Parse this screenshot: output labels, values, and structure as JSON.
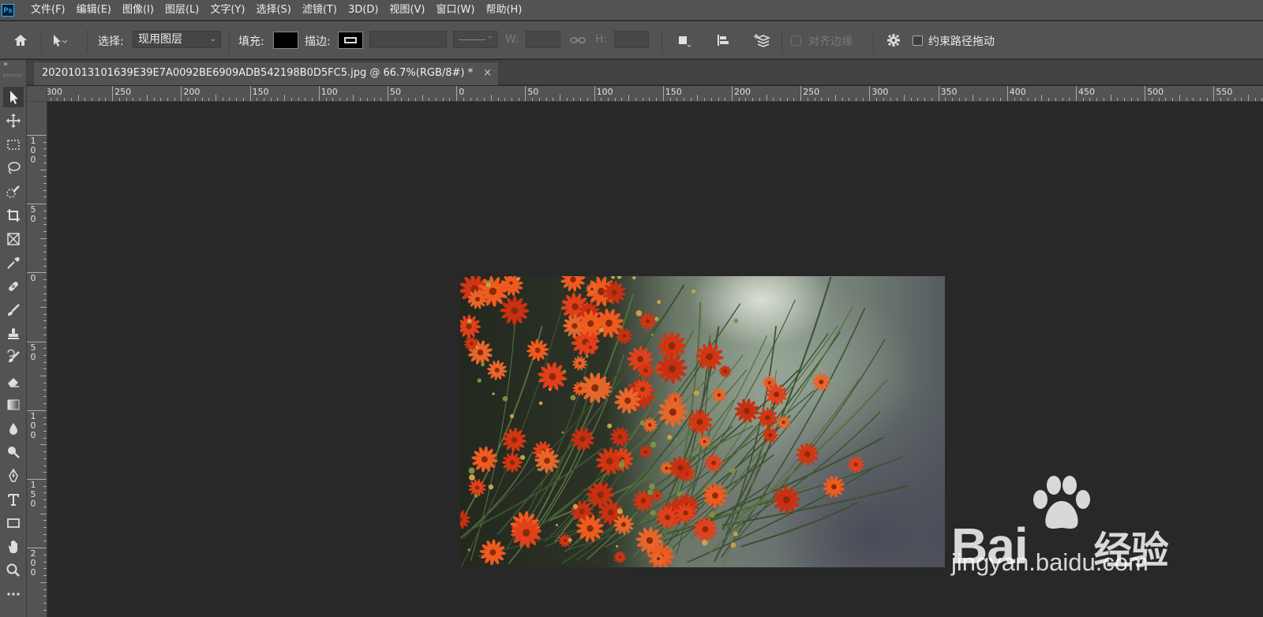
{
  "app": {
    "logo_text": "Ps"
  },
  "menu": [
    {
      "label": "文件(F)"
    },
    {
      "label": "编辑(E)"
    },
    {
      "label": "图像(I)"
    },
    {
      "label": "图层(L)"
    },
    {
      "label": "文字(Y)"
    },
    {
      "label": "选择(S)"
    },
    {
      "label": "滤镜(T)"
    },
    {
      "label": "3D(D)"
    },
    {
      "label": "视图(V)"
    },
    {
      "label": "窗口(W)"
    },
    {
      "label": "帮助(H)"
    }
  ],
  "options": {
    "select_label": "选择:",
    "select_value": "现用图层",
    "fill_label": "填充:",
    "fill_color": "#000000",
    "stroke_label": "描边:",
    "w_label": "W:",
    "h_label": "H:",
    "align_edges_label": "对齐边缘",
    "constrain_path_label": "约束路径拖动"
  },
  "toolbar": {
    "grip": "»",
    "tools": [
      {
        "icon": "path-selection-icon"
      },
      {
        "icon": "move-icon"
      },
      {
        "icon": "marquee-icon"
      },
      {
        "icon": "lasso-icon"
      },
      {
        "icon": "quick-selection-icon"
      },
      {
        "icon": "crop-icon"
      },
      {
        "icon": "frame-icon"
      },
      {
        "icon": "eyedropper-icon"
      },
      {
        "icon": "healing-brush-icon"
      },
      {
        "icon": "brush-icon"
      },
      {
        "icon": "clone-stamp-icon"
      },
      {
        "icon": "history-brush-icon"
      },
      {
        "icon": "eraser-icon"
      },
      {
        "icon": "gradient-icon"
      },
      {
        "icon": "blur-icon"
      },
      {
        "icon": "dodge-icon"
      },
      {
        "icon": "pen-icon"
      },
      {
        "icon": "type-icon"
      },
      {
        "icon": "rectangle-icon"
      },
      {
        "icon": "hand-icon"
      },
      {
        "icon": "zoom-icon"
      },
      {
        "icon": "more-tools-icon"
      }
    ]
  },
  "document": {
    "tab_title": "20201013101639E39E7A0092BE6909ADB542198B0D5FC5.jpg @ 66.7%(RGB/8#) *",
    "close_glyph": "×"
  },
  "rulers": {
    "horizontal_labels": [
      "300",
      "250",
      "200",
      "150",
      "100",
      "50",
      "0",
      "50",
      "100",
      "150",
      "200",
      "250",
      "300",
      "350",
      "400",
      "450",
      "500",
      "550"
    ],
    "vertical_labels": [
      "100",
      "50",
      "0",
      "50",
      "100",
      "150",
      "200"
    ]
  },
  "watermark": {
    "brand": "Bai",
    "brand_suffix": "经验",
    "url": "jingyan.baidu.com"
  },
  "colors": {
    "chrome": "#535353",
    "canvas": "#282828",
    "accent": "#31a8ff"
  }
}
